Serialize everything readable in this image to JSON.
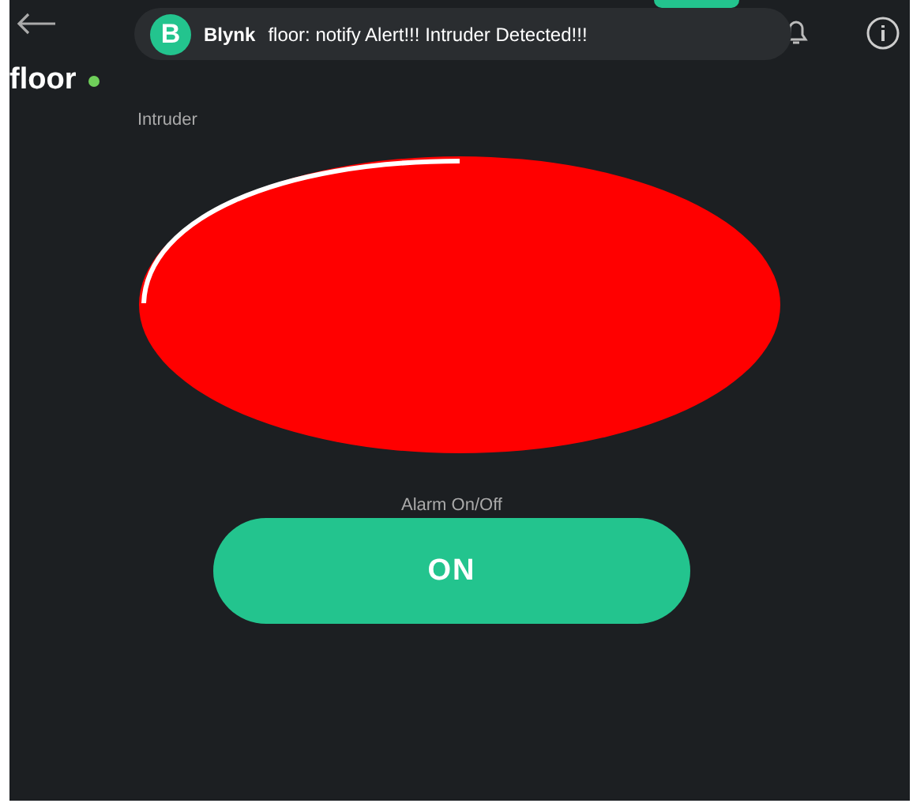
{
  "header": {
    "title": "floor",
    "online": true
  },
  "notification": {
    "app_letter": "B",
    "app": "Blynk",
    "message": "floor: notify Alert!!! Intruder Detected!!!"
  },
  "widgets": [
    {
      "kind": "led",
      "label": "Intruder",
      "on": true
    },
    {
      "kind": "switch",
      "label": "Alarm On/Off",
      "on": true,
      "text": "ON"
    }
  ]
}
